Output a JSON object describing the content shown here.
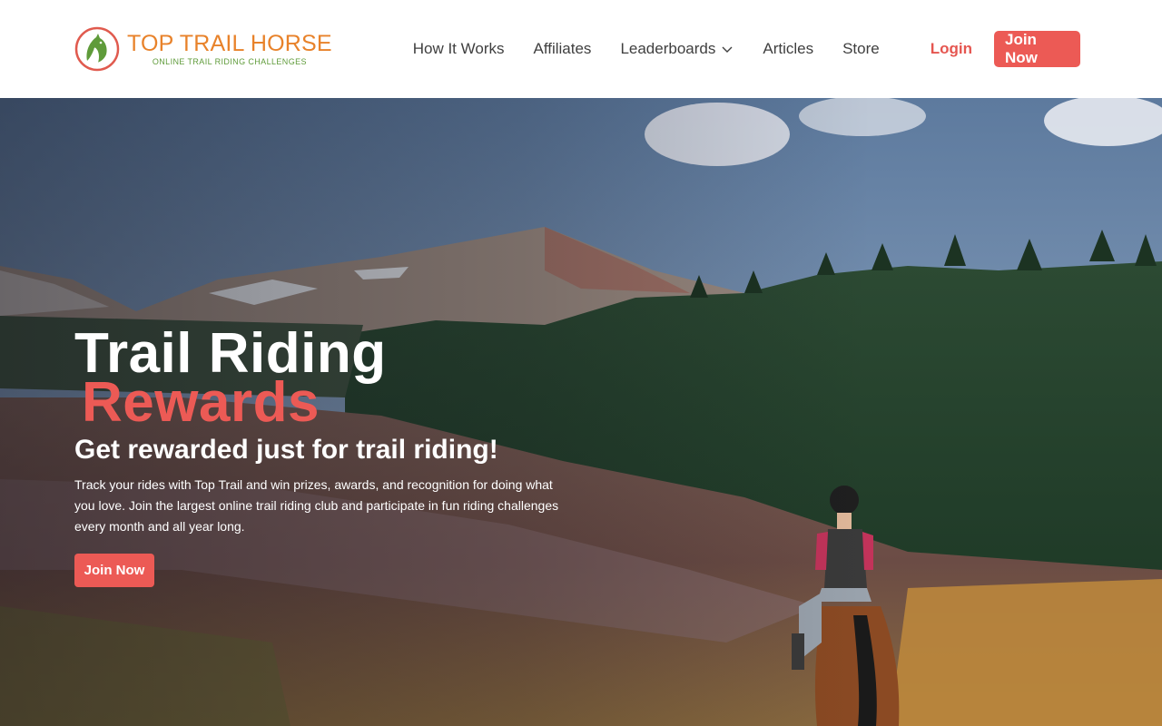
{
  "brand": {
    "name": "TOP TRAIL HORSE",
    "tagline": "ONLINE TRAIL RIDING CHALLENGES",
    "logo_icon": "horse-head-logo",
    "color_primary": "#e8822a",
    "color_secondary": "#5f9b3a"
  },
  "nav": {
    "items": [
      {
        "label": "How It Works"
      },
      {
        "label": "Affiliates"
      },
      {
        "label": "Leaderboards",
        "icon": "chevron-down-icon"
      },
      {
        "label": "Articles"
      },
      {
        "label": "Store"
      }
    ],
    "login_label": "Login",
    "join_label": "Join Now"
  },
  "hero": {
    "title": "Trail Riding",
    "accent": "Rewards",
    "subtitle": "Get rewarded just for trail riding!",
    "description": "Track your rides with Top Trail and win prizes, awards, and recognition for doing what you love. Join the largest online trail riding club and participate in fun riding challenges every month and all year long.",
    "cta_label": "Join Now",
    "accent_color": "#ec5a55"
  }
}
